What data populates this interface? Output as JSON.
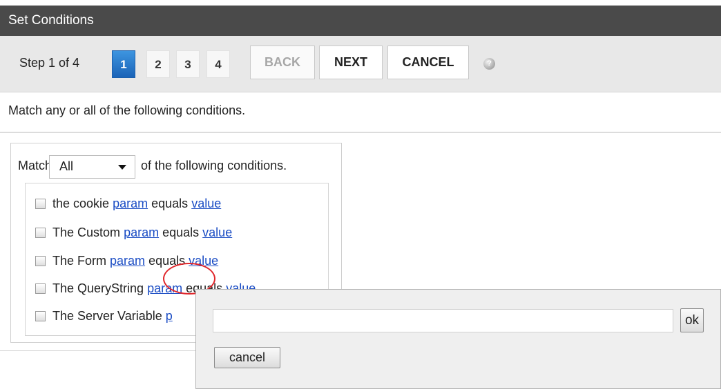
{
  "header": {
    "title": "Set Conditions"
  },
  "wizard": {
    "step_label": "Step 1 of 4",
    "steps": [
      "1",
      "2",
      "3",
      "4"
    ],
    "active_step": "1",
    "back_label": "BACK",
    "next_label": "NEXT",
    "cancel_label": "CANCEL",
    "help_icon": "help-icon"
  },
  "instructions": "Match any or all of the following conditions.",
  "match": {
    "prefix": "Match:",
    "selected": "All",
    "suffix": "of the following conditions."
  },
  "conditions": [
    {
      "prefix": "the cookie",
      "param": "param",
      "mid": "equals",
      "value": "value"
    },
    {
      "prefix": "The Custom",
      "param": "param",
      "mid": "equals",
      "value": "value"
    },
    {
      "prefix": "The Form",
      "param": "param",
      "mid": "equals",
      "value": "value"
    },
    {
      "prefix": "The QueryString",
      "param": "param",
      "mid": "equals",
      "value": "value"
    },
    {
      "prefix": "The Server Variable",
      "param": "p"
    }
  ],
  "popup": {
    "input_value": "",
    "ok_label": "ok",
    "cancel_label": "cancel"
  },
  "colors": {
    "titlebar": "#4a4a4a",
    "active_step": "#1a63b7",
    "link": "#1a4cc4",
    "highlight_ring": "#e0262b"
  }
}
